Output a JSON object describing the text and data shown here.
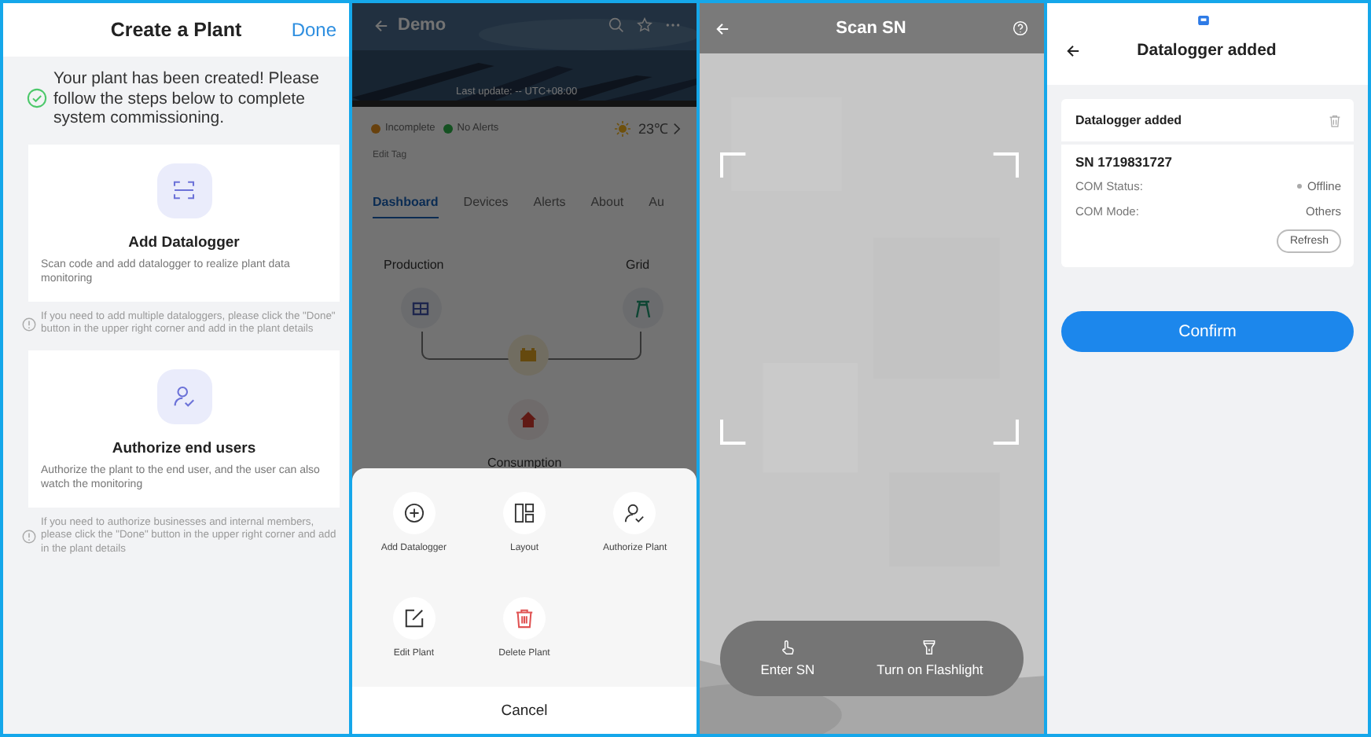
{
  "create_plant": {
    "title": "Create a Plant",
    "done": "Done",
    "message": "Your plant has been created! Please follow the steps below to complete system commissioning.",
    "steps": [
      {
        "kind": "scan",
        "title": "Add Datalogger",
        "description": "Scan code and add datalogger to realize plant data monitoring",
        "hint": "If you need to add multiple dataloggers, please click the \"Done\" button in the upper right corner and add in the plant details"
      },
      {
        "kind": "user",
        "title": "Authorize end users",
        "description": "Authorize the plant to the end user, and the user can also watch the monitoring",
        "hint": "If you need to authorize businesses and internal members, please click the \"Done\" button in the upper right corner and add in the plant details"
      }
    ]
  },
  "plant_detail": {
    "title": "Demo",
    "last_update": "Last update: -- UTC+08:00",
    "statuses": [
      {
        "label": "Incomplete",
        "color": "#68410d"
      },
      {
        "label": "No Alerts",
        "color": "#145121"
      }
    ],
    "temperature": "23℃",
    "edit_tag": "Edit Tag",
    "tabs": [
      {
        "label": "Dashboard",
        "selected": true
      },
      {
        "label": "Devices",
        "selected": false
      },
      {
        "label": "Alerts",
        "selected": false
      },
      {
        "label": "About",
        "selected": false
      },
      {
        "label": "Au",
        "selected": false
      }
    ],
    "flow": {
      "production": "Production",
      "grid": "Grid",
      "consumption": "Consumption"
    },
    "actions": [
      {
        "kind": "add",
        "label": "Add Datalogger"
      },
      {
        "kind": "layout",
        "label": "Layout"
      },
      {
        "kind": "authorize",
        "label": "Authorize Plant"
      },
      {
        "kind": "edit",
        "label": "Edit Plant"
      },
      {
        "kind": "delete",
        "label": "Delete Plant"
      }
    ],
    "cancel": "Cancel"
  },
  "scan": {
    "title": "Scan SN",
    "buttons": [
      {
        "kind": "hand",
        "label": "Enter SN"
      },
      {
        "kind": "flashlight",
        "label": "Turn on Flashlight"
      }
    ]
  },
  "datalogger": {
    "title": "Datalogger added",
    "card_title": "Datalogger added",
    "sn": "SN 1719831727",
    "fields": [
      {
        "label": "COM Status:",
        "value": "Offline",
        "kind": "status"
      },
      {
        "label": "COM Mode:",
        "value": "Others",
        "kind": "plain"
      }
    ],
    "refresh": "Refresh",
    "confirm": "Confirm"
  }
}
